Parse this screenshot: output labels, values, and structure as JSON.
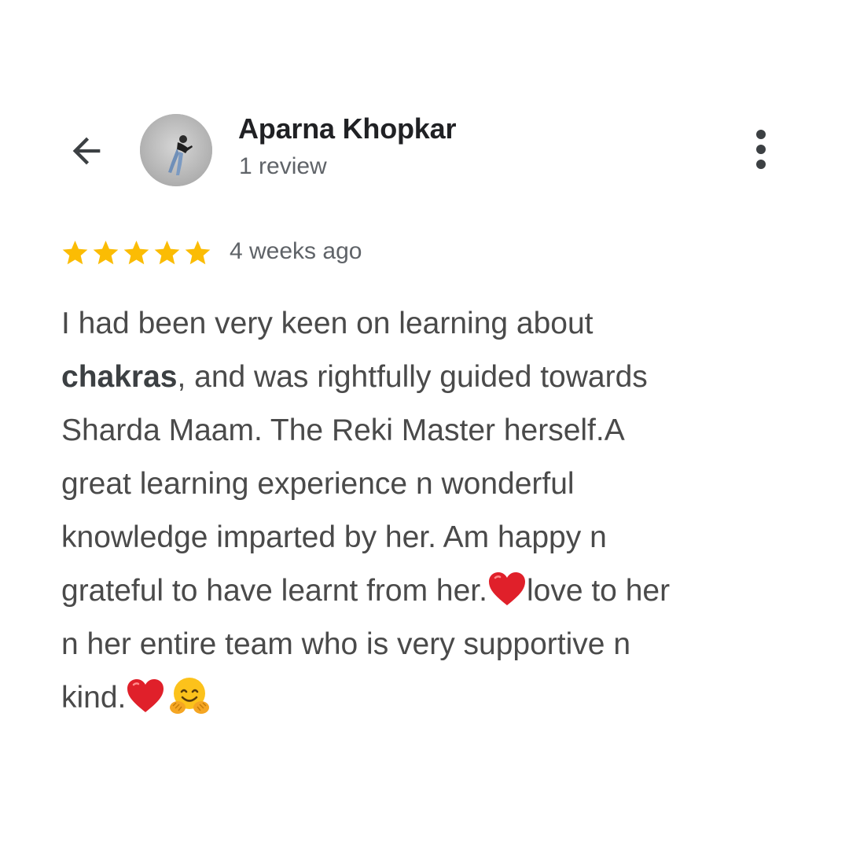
{
  "header": {
    "author_name": "Aparna Khopkar",
    "review_count": "1 review",
    "back_icon": "arrow-left-icon",
    "more_icon": "more-vertical-icon"
  },
  "rating": {
    "stars": 5,
    "max_stars": 5,
    "star_color": "#fbbc04",
    "date": "4 weeks ago"
  },
  "review": {
    "lines": [
      {
        "before": "I had been very keen on learning about"
      },
      {
        "bold": "chakras",
        "after": ", and was rightfully guided towards"
      },
      {
        "before": "Sharda Maam. The Reki Master herself.A"
      },
      {
        "before": "great learning experience n wonderful"
      },
      {
        "before": "knowledge imparted by her. Am happy n"
      },
      {
        "before": "grateful to have learnt from her.",
        "emoji": "red-heart-icon",
        "after": "love to her"
      },
      {
        "before": "n her entire team who is very supportive n"
      },
      {
        "before": "kind.",
        "emoji": "red-heart-icon",
        "emoji2": "hugging-face-icon"
      }
    ]
  }
}
